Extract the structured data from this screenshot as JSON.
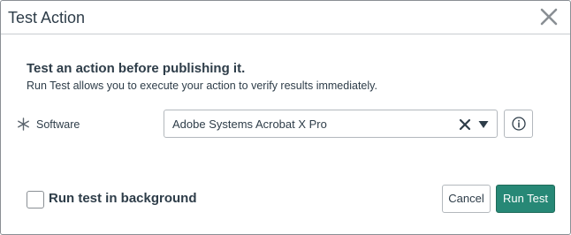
{
  "dialog": {
    "title": "Test Action"
  },
  "intro": {
    "heading": "Test an action before publishing it.",
    "description": "Run Test allows you to execute your action to verify results immediately."
  },
  "form": {
    "software": {
      "label": "Software",
      "required": true,
      "value": "Adobe Systems Acrobat X Pro"
    }
  },
  "footer": {
    "background_label": "Run test in background",
    "background_checked": false,
    "cancel_label": "Cancel",
    "run_label": "Run Test"
  },
  "colors": {
    "primary": "#278876",
    "text": "#2e3d49",
    "border": "#b3b8bd"
  },
  "icons": {
    "close": "close-icon",
    "required": "asterisk-icon",
    "clear": "clear-icon",
    "caret": "caret-down-icon",
    "info": "info-icon"
  }
}
